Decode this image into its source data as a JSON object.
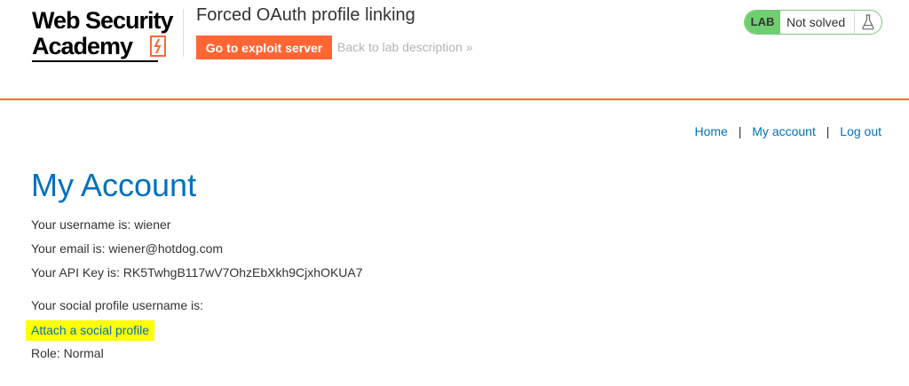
{
  "header": {
    "logo": {
      "line1": "Web Security",
      "line2": "Academy"
    },
    "lab_title": "Forced OAuth profile linking",
    "exploit_button": "Go to exploit server",
    "back_link": "Back to lab description",
    "back_chevron": "»",
    "status": {
      "tag": "LAB",
      "state": "Not solved"
    }
  },
  "nav": {
    "home": "Home",
    "sep": "|",
    "my_account": "My account",
    "log_out": "Log out"
  },
  "main": {
    "title": "My Account",
    "username_line": "Your username is: wiener",
    "email_line": "Your email is: wiener@hotdog.com",
    "api_key_line": "Your API Key is: RK5TwhgB117wV7OhzEbXkh9CjxhOKUA7",
    "social_line": "Your social profile username is:",
    "attach_link": "Attach a social profile",
    "role_line": "Role: Normal"
  },
  "colors": {
    "accent": "#ff6633",
    "link": "#0071bc",
    "lab_green": "#6fcf6f",
    "highlight": "#ffff00"
  }
}
